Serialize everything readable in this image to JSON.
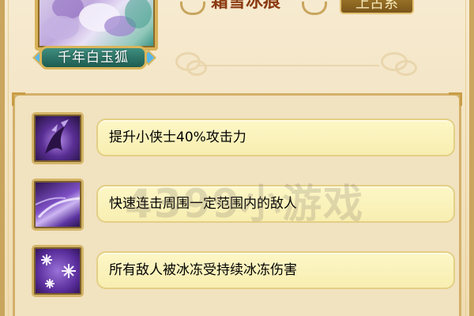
{
  "pet": {
    "name_label": "千年白玉狐",
    "title": "霜雪冰痕",
    "grade": "上古系"
  },
  "skills": [
    {
      "icon": "claw-strike-icon",
      "description": "提升小侠士40%攻击力"
    },
    {
      "icon": "slash-arc-icon",
      "description": "快速连击周围一定范围内的敌人"
    },
    {
      "icon": "snowflake-freeze-icon",
      "description": "所有敌人被冰冻受持续冰冻伤害"
    }
  ],
  "watermark": "4399小游戏",
  "colors": {
    "parchment": "#f3e3bf",
    "gold_border": "#d4b467",
    "desc_box": "#fdf7c6",
    "skill_icon_purple": "#6b3fa8",
    "name_plate": "#2f7a6c"
  }
}
